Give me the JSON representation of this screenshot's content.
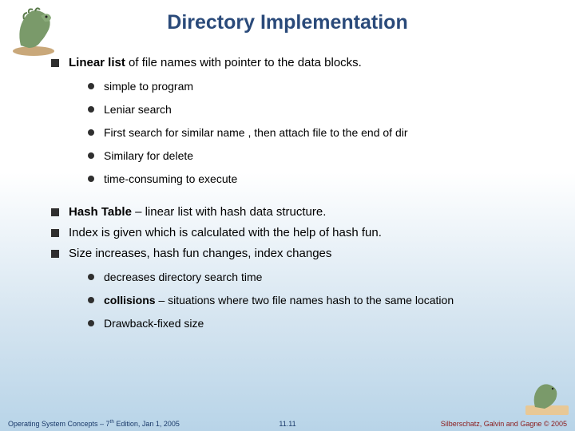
{
  "title": "Directory Implementation",
  "bullets": {
    "b1_pre": "Linear list",
    "b1_post": " of file names with pointer to the data blocks.",
    "b1_1": "simple to program",
    "b1_2": "Leniar search",
    "b1_3": "First search for similar name , then attach file to the end of dir",
    "b1_4": "Similary for delete",
    "b1_5": "time-consuming to execute",
    "b2_pre": "Hash Table",
    "b2_post": " – linear list with hash data structure.",
    "b3": "Index is given which is calculated with the help of hash fun.",
    "b4": "Size increases, hash fun changes, index changes",
    "b4_1": "decreases directory search time",
    "b4_2a": "collisions",
    "b4_2b": " – situations where two file names hash to the same location",
    "b4_3": "Drawback-fixed size"
  },
  "footer": {
    "left_a": "Operating System Concepts – 7",
    "left_sup": "th",
    "left_b": " Edition, Jan 1, 2005",
    "mid": "11.11",
    "right": "Silberschatz, Galvin and Gagne © 2005"
  }
}
